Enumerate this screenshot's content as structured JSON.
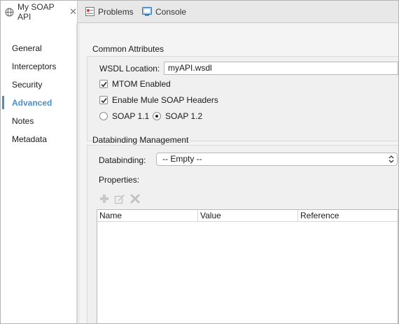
{
  "tabs": [
    {
      "label": "My SOAP API",
      "icon": "globe-icon",
      "active": true
    },
    {
      "label": "Problems",
      "icon": "problems-icon",
      "active": false
    },
    {
      "label": "Console",
      "icon": "console-icon",
      "active": false
    }
  ],
  "sidebar": {
    "items": [
      {
        "label": "General"
      },
      {
        "label": "Interceptors"
      },
      {
        "label": "Security"
      },
      {
        "label": "Advanced"
      },
      {
        "label": "Notes"
      },
      {
        "label": "Metadata"
      }
    ],
    "active_index": 3,
    "active_color": "#4a90c8"
  },
  "common": {
    "title": "Common Attributes",
    "wsdl_label": "WSDL Location:",
    "wsdl_value": "myAPI.wsdl",
    "mtom_label": "MTOM Enabled",
    "mtom_checked": true,
    "mule_headers_label": "Enable Mule SOAP Headers",
    "mule_headers_checked": true,
    "soap11_label": "SOAP 1.1",
    "soap12_label": "SOAP 1.2",
    "soap_selected": "SOAP 1.2"
  },
  "databinding": {
    "title": "Databinding Management",
    "label": "Databinding:",
    "value": "-- Empty --",
    "properties_label": "Properties:",
    "toolbar_icons": [
      "add-icon",
      "edit-icon",
      "delete-icon"
    ],
    "columns": [
      "Name",
      "Value",
      "Reference"
    ]
  }
}
